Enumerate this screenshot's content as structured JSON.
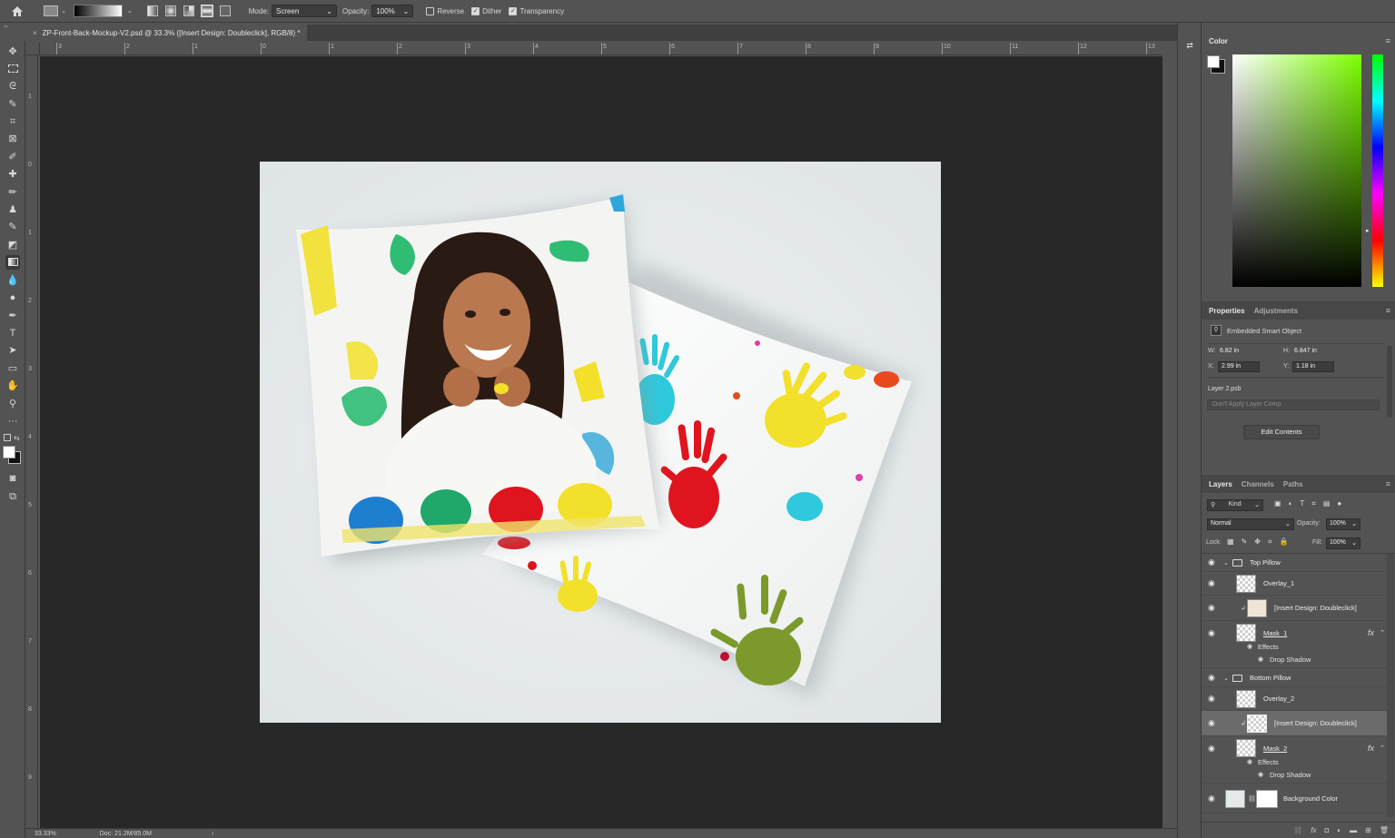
{
  "options_bar": {
    "mode_label": "Mode:",
    "mode_value": "Screen",
    "opacity_label": "Opacity:",
    "opacity_value": "100%",
    "reverse_label": "Reverse",
    "dither_label": "Dither",
    "transparency_label": "Transparency",
    "reverse_checked": false,
    "dither_checked": true,
    "transparency_checked": true
  },
  "document": {
    "tab_title": "ZP-Front-Back-Mockup-V2.psd @ 33.3% ([Insert Design: Doubleclick], RGB/8) *",
    "close_glyph": "×"
  },
  "rulers": {
    "horizontal": [
      "3",
      "2",
      "1",
      "0",
      "1",
      "2",
      "3",
      "4",
      "5",
      "6",
      "7",
      "8",
      "9",
      "10",
      "11",
      "12",
      "13"
    ],
    "vertical": [
      "1",
      "0",
      "1",
      "2",
      "3",
      "4",
      "5",
      "6",
      "7",
      "8",
      "9"
    ]
  },
  "status": {
    "zoom": "33.33%",
    "doc_size": "Doc: 21.2M/85.0M",
    "arrow": "›"
  },
  "color_panel": {
    "title": "Color",
    "hue_color": "#7cff00"
  },
  "properties_panel": {
    "tabs": [
      "Properties",
      "Adjustments"
    ],
    "object_type": "Embedded Smart Object",
    "w_label": "W:",
    "w_value": "6.82 in",
    "h_label": "H:",
    "h_value": "6.847 in",
    "x_label": "X:",
    "x_value": "2.99 in",
    "y_label": "Y:",
    "y_value": "1.18 in",
    "file_name": "Layer 2.psb",
    "layer_comp_placeholder": "Don't Apply Layer Comp",
    "edit_button": "Edit Contents"
  },
  "layers_panel": {
    "tabs": [
      "Layers",
      "Channels",
      "Paths"
    ],
    "kind_label": "Kind",
    "blend_mode": "Normal",
    "opacity_label": "Opacity:",
    "opacity_value": "100%",
    "lock_label": "Lock:",
    "fill_label": "Fill:",
    "fill_value": "100%",
    "layers": [
      {
        "name": "Top Pillow",
        "type": "group"
      },
      {
        "name": "Overlay_1",
        "type": "layer"
      },
      {
        "name": "[Insert Design: Doubleclick]",
        "type": "smart"
      },
      {
        "name": "Mask_1",
        "type": "layer",
        "fx": "fx"
      },
      {
        "name": "Effects",
        "type": "effects"
      },
      {
        "name": "Drop Shadow",
        "type": "effect"
      },
      {
        "name": "Bottom Pillow",
        "type": "group"
      },
      {
        "name": "Overlay_2",
        "type": "layer"
      },
      {
        "name": "[Insert Design: Doubleclick]",
        "type": "smart",
        "selected": true
      },
      {
        "name": "Mask_2",
        "type": "layer",
        "fx": "fx"
      },
      {
        "name": "Effects",
        "type": "effects"
      },
      {
        "name": "Drop Shadow",
        "type": "effect"
      },
      {
        "name": "Background Color",
        "type": "fill"
      }
    ]
  }
}
